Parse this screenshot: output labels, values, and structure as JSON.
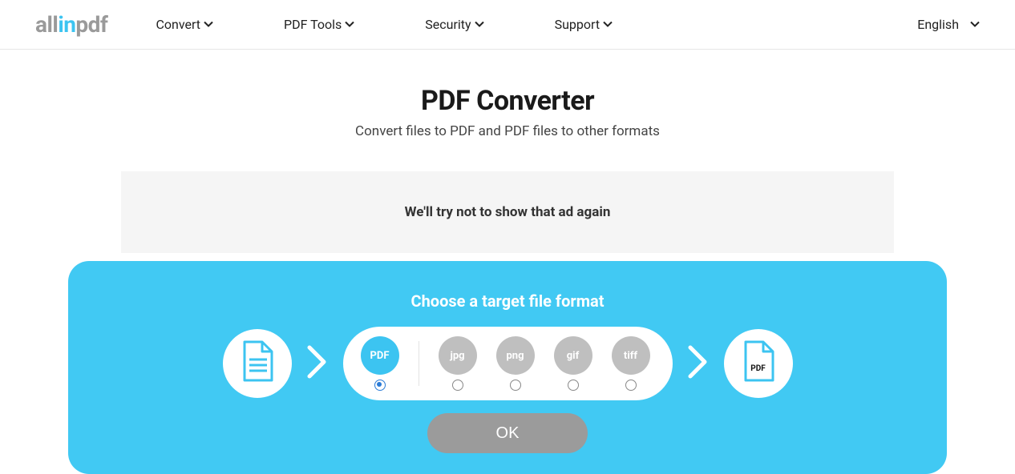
{
  "logo": {
    "part1": "all",
    "part2": "in",
    "part3": "pdf"
  },
  "nav": {
    "convert": "Convert",
    "pdftools": "PDF Tools",
    "security": "Security",
    "support": "Support"
  },
  "language": "English",
  "page": {
    "title": "PDF Converter",
    "subtitle": "Convert files to PDF and PDF files to other formats"
  },
  "ad": {
    "message": "We'll try not to show that ad again"
  },
  "panel": {
    "heading": "Choose a target file format",
    "formats": {
      "pdf": "PDF",
      "jpg": "jpg",
      "png": "png",
      "gif": "gif",
      "tiff": "tiff"
    },
    "selected": "pdf",
    "target_label": "PDF",
    "ok": "OK"
  }
}
